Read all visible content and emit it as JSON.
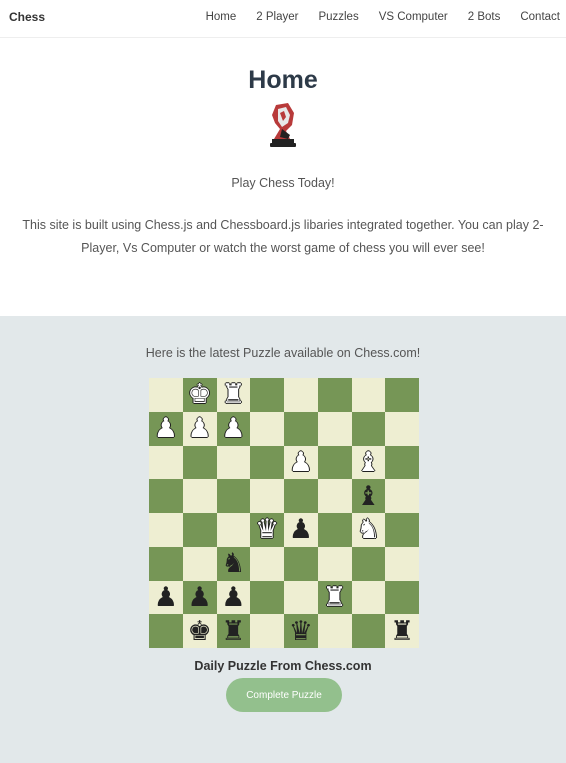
{
  "nav": {
    "brand": "Chess",
    "links": [
      "Home",
      "2 Player",
      "Puzzles",
      "VS Computer",
      "2 Bots",
      "Contact"
    ]
  },
  "home": {
    "title": "Home",
    "logo_icon": "chess-knight-logo-icon",
    "tagline": "Play Chess Today!",
    "description": "This site is built using Chess.js and Chessboard.js libaries integrated together. You can play 2-Player, Vs Computer or watch the worst game of chess you will ever see!"
  },
  "puzzle": {
    "intro": "Here is the latest Puzzle available on Chess.com!",
    "caption": "Daily Puzzle From Chess.com",
    "button": "Complete Puzzle",
    "colors": {
      "light": "#eeeed2",
      "dark": "#769656",
      "button": "#93c08d",
      "section_bg": "#e2e8ea"
    },
    "board": [
      [
        "",
        "wK",
        "wR",
        "",
        "",
        "",
        "",
        ""
      ],
      [
        "wP",
        "wP",
        "wP",
        "",
        "",
        "",
        "",
        ""
      ],
      [
        "",
        "",
        "",
        "",
        "wP",
        "",
        "wB",
        ""
      ],
      [
        "",
        "",
        "",
        "",
        "",
        "",
        "bB",
        ""
      ],
      [
        "",
        "",
        "",
        "wQ",
        "bP",
        "",
        "wN",
        ""
      ],
      [
        "",
        "",
        "bN",
        "",
        "",
        "",
        "",
        ""
      ],
      [
        "bP",
        "bP",
        "bP",
        "",
        "",
        "wR",
        "",
        ""
      ],
      [
        "",
        "bK",
        "bR",
        "",
        "bQ",
        "",
        "",
        "bR"
      ]
    ]
  }
}
